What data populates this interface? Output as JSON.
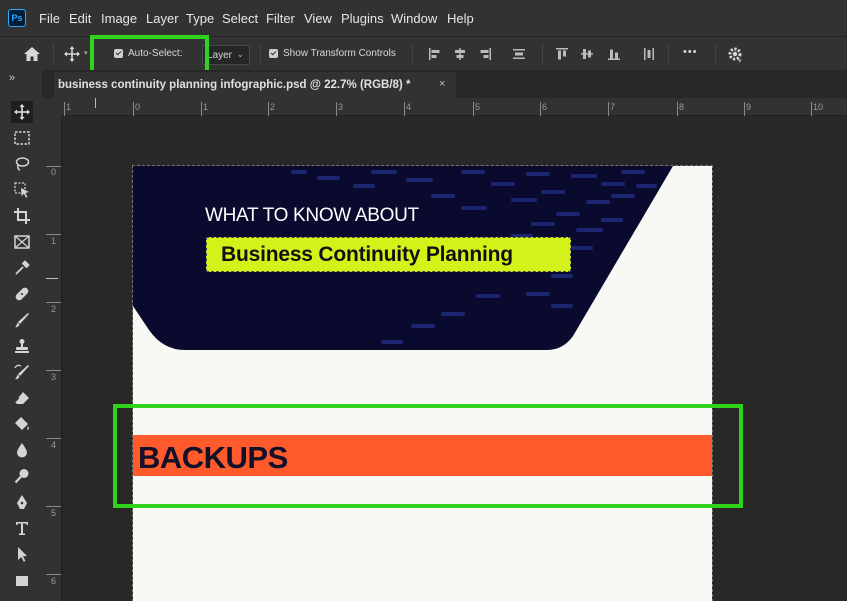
{
  "app": {
    "logo": "Ps"
  },
  "menu": [
    "File",
    "Edit",
    "Image",
    "Layer",
    "Type",
    "Select",
    "Filter",
    "View",
    "Plugins",
    "Window",
    "Help"
  ],
  "options": {
    "auto_select_label": "Auto-Select:",
    "auto_select_checked": true,
    "auto_select_target": "Layer",
    "show_transform_label": "Show Transform Controls",
    "show_transform_checked": true,
    "more_label": "•••"
  },
  "panel_collapse": "»",
  "document_tab": {
    "title": "business continuity planning infographic.psd @ 22.7% (RGB/8) *",
    "close": "×"
  },
  "ruler_h": [
    "1",
    "0",
    "1",
    "2",
    "3",
    "4",
    "5",
    "6",
    "7",
    "8",
    "9",
    "10"
  ],
  "ruler_v": [
    "0",
    "1",
    "2",
    "3",
    "4",
    "5",
    "6"
  ],
  "canvas": {
    "eyebrow": "WHAT TO KNOW ABOUT",
    "title": "Business Continuity Planning",
    "section": "BACKUPS"
  },
  "colors": {
    "navy": "#0a0a2e",
    "lime": "#d4f21a",
    "orange": "#ff5a2b",
    "highlight": "#2fd31c"
  }
}
